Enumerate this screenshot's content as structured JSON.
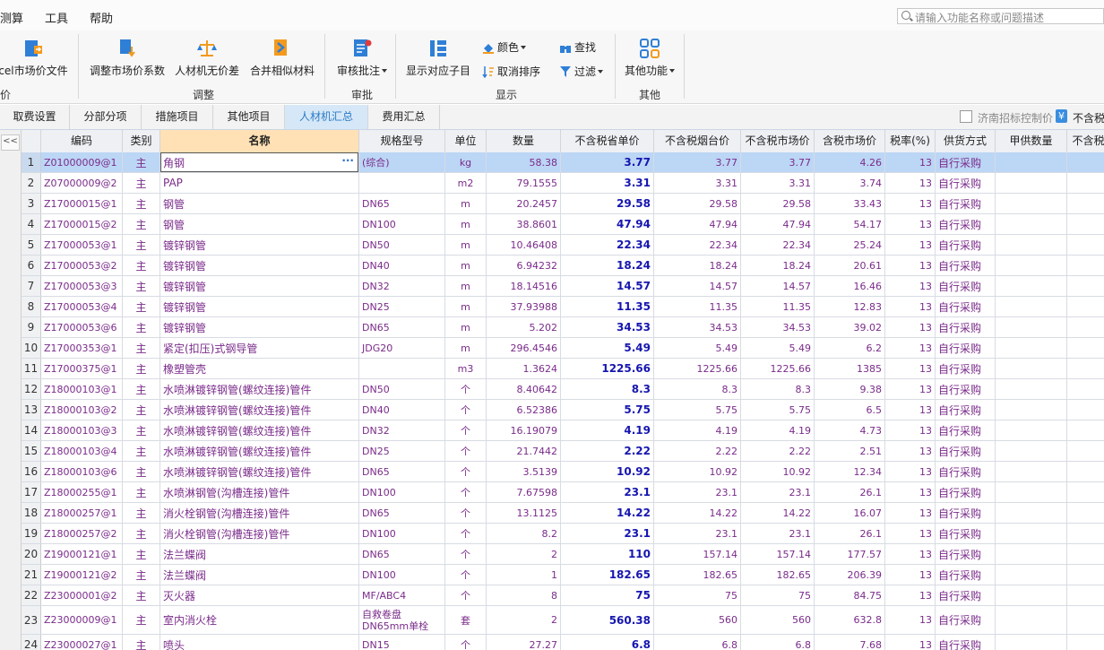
{
  "menu": {
    "items": [
      "测算",
      "工具",
      "帮助"
    ]
  },
  "search": {
    "placeholder": "请输入功能名称或问题描述"
  },
  "ribbon": {
    "excel_label": "cel市场价文件",
    "group_first_tail": "价",
    "adjust_coef": "调整市场价系数",
    "rcj_nodiff": "人材机无价差",
    "merge_similar": "合并相似材料",
    "group_adjust": "调整",
    "review_note": "审核批注",
    "group_review": "审批",
    "show_child": "显示对应子目",
    "color": "颜色",
    "cancel_sort": "取消排序",
    "find": "查找",
    "filter": "过滤",
    "group_display": "显示",
    "other_func": "其他功能",
    "group_other": "其他"
  },
  "tabs": [
    "取费设置",
    "分部分项",
    "措施项目",
    "其他项目",
    "人材机汇总",
    "费用汇总"
  ],
  "tabs_right": {
    "checkbox_label": "济南招标控制价",
    "yen_symbol": "¥",
    "label2": "不含税"
  },
  "collapse_symbol": "<<",
  "grid": {
    "headers": [
      "",
      "编码",
      "类别",
      "名称",
      "规格型号",
      "单位",
      "数量",
      "不含税省单价",
      "不含税烟台价",
      "不含税市场价",
      "含税市场价",
      "税率(%)",
      "供货方式",
      "甲供数量",
      "不含税市"
    ],
    "rows": [
      {
        "no": "1",
        "code": "Z01000009@1",
        "type": "主",
        "name": "角钢",
        "spec": "(综合)",
        "unit": "kg",
        "qty": "58.38",
        "prov": "3.77",
        "yt": "3.77",
        "mkt": "3.77",
        "tax": "4.26",
        "rate": "13",
        "supply": "自行采购"
      },
      {
        "no": "2",
        "code": "Z07000009@2",
        "type": "主",
        "name": "PAP",
        "spec": "",
        "unit": "m2",
        "qty": "79.1555",
        "prov": "3.31",
        "yt": "3.31",
        "mkt": "3.31",
        "tax": "3.74",
        "rate": "13",
        "supply": "自行采购"
      },
      {
        "no": "3",
        "code": "Z17000015@1",
        "type": "主",
        "name": "钢管",
        "spec": "DN65",
        "unit": "m",
        "qty": "20.2457",
        "prov": "29.58",
        "yt": "29.58",
        "mkt": "29.58",
        "tax": "33.43",
        "rate": "13",
        "supply": "自行采购"
      },
      {
        "no": "4",
        "code": "Z17000015@2",
        "type": "主",
        "name": "钢管",
        "spec": "DN100",
        "unit": "m",
        "qty": "38.8601",
        "prov": "47.94",
        "yt": "47.94",
        "mkt": "47.94",
        "tax": "54.17",
        "rate": "13",
        "supply": "自行采购"
      },
      {
        "no": "5",
        "code": "Z17000053@1",
        "type": "主",
        "name": "镀锌钢管",
        "spec": "DN50",
        "unit": "m",
        "qty": "10.46408",
        "prov": "22.34",
        "yt": "22.34",
        "mkt": "22.34",
        "tax": "25.24",
        "rate": "13",
        "supply": "自行采购"
      },
      {
        "no": "6",
        "code": "Z17000053@2",
        "type": "主",
        "name": "镀锌钢管",
        "spec": "DN40",
        "unit": "m",
        "qty": "6.94232",
        "prov": "18.24",
        "yt": "18.24",
        "mkt": "18.24",
        "tax": "20.61",
        "rate": "13",
        "supply": "自行采购"
      },
      {
        "no": "7",
        "code": "Z17000053@3",
        "type": "主",
        "name": "镀锌钢管",
        "spec": "DN32",
        "unit": "m",
        "qty": "18.14516",
        "prov": "14.57",
        "yt": "14.57",
        "mkt": "14.57",
        "tax": "16.46",
        "rate": "13",
        "supply": "自行采购"
      },
      {
        "no": "8",
        "code": "Z17000053@4",
        "type": "主",
        "name": "镀锌钢管",
        "spec": "DN25",
        "unit": "m",
        "qty": "37.93988",
        "prov": "11.35",
        "yt": "11.35",
        "mkt": "11.35",
        "tax": "12.83",
        "rate": "13",
        "supply": "自行采购"
      },
      {
        "no": "9",
        "code": "Z17000053@6",
        "type": "主",
        "name": "镀锌钢管",
        "spec": "DN65",
        "unit": "m",
        "qty": "5.202",
        "prov": "34.53",
        "yt": "34.53",
        "mkt": "34.53",
        "tax": "39.02",
        "rate": "13",
        "supply": "自行采购"
      },
      {
        "no": "10",
        "code": "Z17000353@1",
        "type": "主",
        "name": "紧定(扣压)式钢导管",
        "spec": "JDG20",
        "unit": "m",
        "qty": "296.4546",
        "prov": "5.49",
        "yt": "5.49",
        "mkt": "5.49",
        "tax": "6.2",
        "rate": "13",
        "supply": "自行采购"
      },
      {
        "no": "11",
        "code": "Z17000375@1",
        "type": "主",
        "name": "橡塑管壳",
        "spec": "",
        "unit": "m3",
        "qty": "1.3624",
        "prov": "1225.66",
        "yt": "1225.66",
        "mkt": "1225.66",
        "tax": "1385",
        "rate": "13",
        "supply": "自行采购"
      },
      {
        "no": "12",
        "code": "Z18000103@1",
        "type": "主",
        "name": "水喷淋镀锌钢管(螺纹连接)管件",
        "spec": "DN50",
        "unit": "个",
        "qty": "8.40642",
        "prov": "8.3",
        "yt": "8.3",
        "mkt": "8.3",
        "tax": "9.38",
        "rate": "13",
        "supply": "自行采购"
      },
      {
        "no": "13",
        "code": "Z18000103@2",
        "type": "主",
        "name": "水喷淋镀锌钢管(螺纹连接)管件",
        "spec": "DN40",
        "unit": "个",
        "qty": "6.52386",
        "prov": "5.75",
        "yt": "5.75",
        "mkt": "5.75",
        "tax": "6.5",
        "rate": "13",
        "supply": "自行采购"
      },
      {
        "no": "14",
        "code": "Z18000103@3",
        "type": "主",
        "name": "水喷淋镀锌钢管(螺纹连接)管件",
        "spec": "DN32",
        "unit": "个",
        "qty": "16.19079",
        "prov": "4.19",
        "yt": "4.19",
        "mkt": "4.19",
        "tax": "4.73",
        "rate": "13",
        "supply": "自行采购"
      },
      {
        "no": "15",
        "code": "Z18000103@4",
        "type": "主",
        "name": "水喷淋镀锌钢管(螺纹连接)管件",
        "spec": "DN25",
        "unit": "个",
        "qty": "21.7442",
        "prov": "2.22",
        "yt": "2.22",
        "mkt": "2.22",
        "tax": "2.51",
        "rate": "13",
        "supply": "自行采购"
      },
      {
        "no": "16",
        "code": "Z18000103@6",
        "type": "主",
        "name": "水喷淋镀锌钢管(螺纹连接)管件",
        "spec": "DN65",
        "unit": "个",
        "qty": "3.5139",
        "prov": "10.92",
        "yt": "10.92",
        "mkt": "10.92",
        "tax": "12.34",
        "rate": "13",
        "supply": "自行采购"
      },
      {
        "no": "17",
        "code": "Z18000255@1",
        "type": "主",
        "name": "水喷淋钢管(沟槽连接)管件",
        "spec": "DN100",
        "unit": "个",
        "qty": "7.67598",
        "prov": "23.1",
        "yt": "23.1",
        "mkt": "23.1",
        "tax": "26.1",
        "rate": "13",
        "supply": "自行采购"
      },
      {
        "no": "18",
        "code": "Z18000257@1",
        "type": "主",
        "name": "消火栓钢管(沟槽连接)管件",
        "spec": "DN65",
        "unit": "个",
        "qty": "13.1125",
        "prov": "14.22",
        "yt": "14.22",
        "mkt": "14.22",
        "tax": "16.07",
        "rate": "13",
        "supply": "自行采购"
      },
      {
        "no": "19",
        "code": "Z18000257@2",
        "type": "主",
        "name": "消火栓钢管(沟槽连接)管件",
        "spec": "DN100",
        "unit": "个",
        "qty": "8.2",
        "prov": "23.1",
        "yt": "23.1",
        "mkt": "23.1",
        "tax": "26.1",
        "rate": "13",
        "supply": "自行采购"
      },
      {
        "no": "20",
        "code": "Z19000121@1",
        "type": "主",
        "name": "法兰蝶阀",
        "spec": "DN65",
        "unit": "个",
        "qty": "2",
        "prov": "110",
        "yt": "157.14",
        "mkt": "157.14",
        "tax": "177.57",
        "rate": "13",
        "supply": "自行采购"
      },
      {
        "no": "21",
        "code": "Z19000121@2",
        "type": "主",
        "name": "法兰蝶阀",
        "spec": "DN100",
        "unit": "个",
        "qty": "1",
        "prov": "182.65",
        "yt": "182.65",
        "mkt": "182.65",
        "tax": "206.39",
        "rate": "13",
        "supply": "自行采购"
      },
      {
        "no": "22",
        "code": "Z23000001@2",
        "type": "主",
        "name": "灭火器",
        "spec": "MF/ABC4",
        "unit": "个",
        "qty": "8",
        "prov": "75",
        "yt": "75",
        "mkt": "75",
        "tax": "84.75",
        "rate": "13",
        "supply": "自行采购"
      },
      {
        "no": "23",
        "code": "Z23000009@1",
        "type": "主",
        "name": "室内消火栓",
        "spec": "自救卷盘 DN65mm单栓",
        "unit": "套",
        "qty": "2",
        "prov": "560.38",
        "yt": "560",
        "mkt": "560",
        "tax": "632.8",
        "rate": "13",
        "supply": "自行采购"
      },
      {
        "no": "24",
        "code": "Z23000027@1",
        "type": "主",
        "name": "喷头",
        "spec": "DN15",
        "unit": "个",
        "qty": "27.27",
        "prov": "6.8",
        "yt": "6.8",
        "mkt": "6.8",
        "tax": "7.68",
        "rate": "13",
        "supply": "自行采购"
      }
    ]
  }
}
